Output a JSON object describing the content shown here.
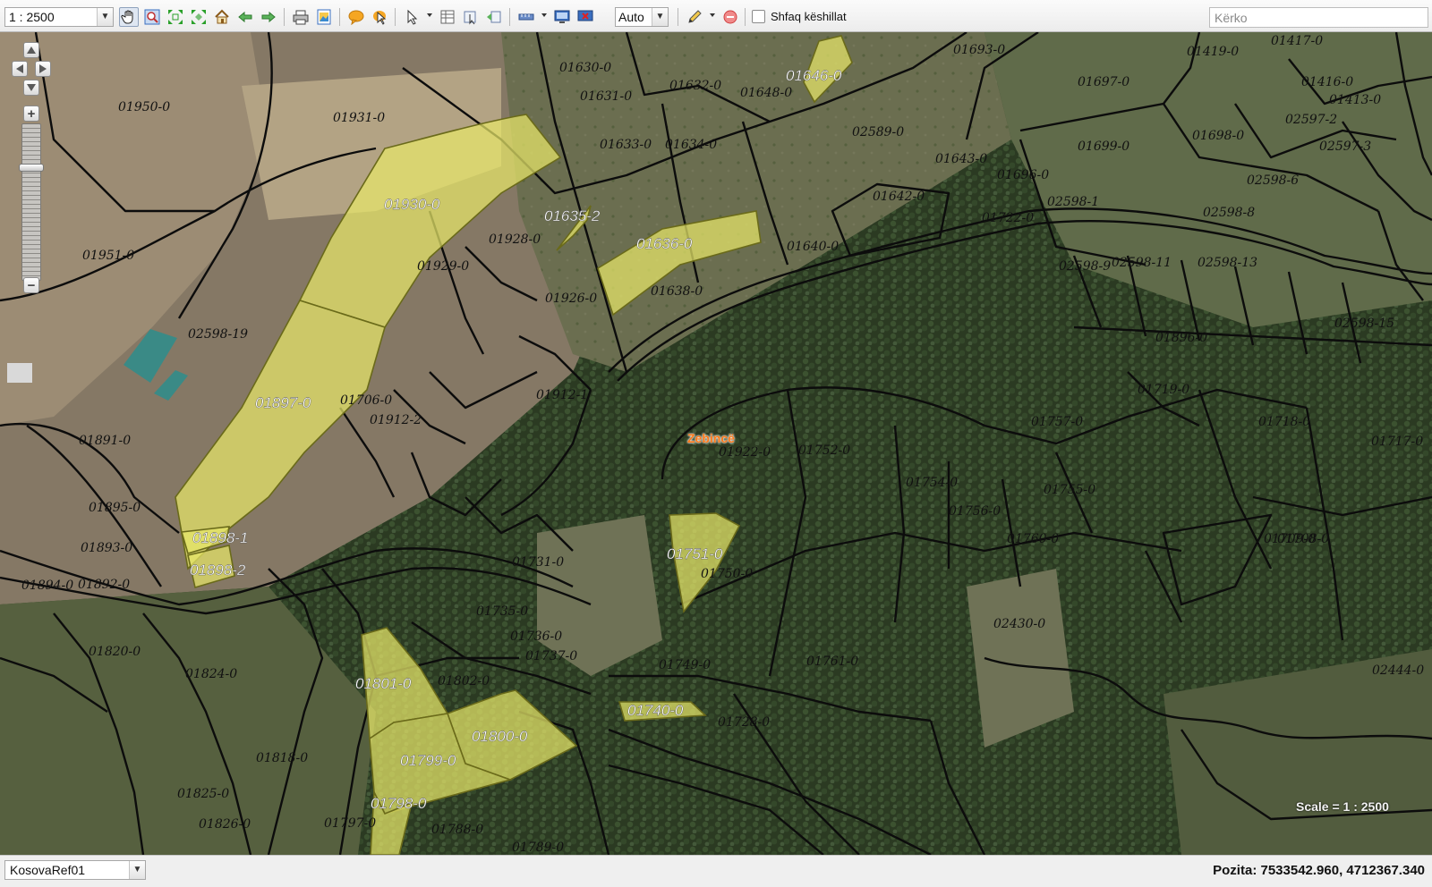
{
  "toolbar": {
    "scale_value": "1 : 2500",
    "zoom_mode_value": "Auto",
    "tips_label": "Shfaq këshillat",
    "tips_checked": false,
    "search_placeholder": "Kërko",
    "tools": [
      "hand-pan-icon",
      "zoom-box-icon",
      "zoom-extent-icon",
      "zoom-layer-icon",
      "home-icon",
      "back-arrow-icon",
      "forward-arrow-icon",
      "print-icon",
      "export-image-icon",
      "speech-bubble-icon",
      "identify-icon",
      "select-pointer-icon",
      "table-icon",
      "query-icon",
      "clear-selection-icon",
      "measure-ruler-icon",
      "coordinates-icon",
      "delete-map-icon",
      "pencil-icon",
      "remove-icon"
    ]
  },
  "map": {
    "place_name": "Zebincë",
    "scale_text": "Scale = 1 : 2500",
    "highlight_color": "#e8e86a",
    "selected_parcels": [
      "01646-0",
      "01930-0",
      "01635-2",
      "01636-0",
      "01897-0",
      "01898-1",
      "01898-2",
      "01751-0",
      "01801-0",
      "01800-0",
      "01799-0",
      "01798-0",
      "01740-0"
    ],
    "parcel_labels": [
      "01950-0",
      "01931-0",
      "01630-0",
      "01631-0",
      "01632-0",
      "01648-0",
      "01693-0",
      "01419-0",
      "01417-0",
      "01697-0",
      "01416-0",
      "01413-0",
      "01698-0",
      "01699-0",
      "02597-2",
      "02597-3",
      "02589-0",
      "01633-0",
      "01634-0",
      "01643-0",
      "01696-0",
      "01642-0",
      "02598-6",
      "02598-1",
      "02598-8",
      "01951-0",
      "01928-0",
      "01929-0",
      "01926-0",
      "01638-0",
      "01640-0",
      "01722-0",
      "02598-9",
      "02598-11",
      "02598-13",
      "02598-15",
      "02598-19",
      "01896-0",
      "01719-0",
      "01718-0",
      "01717-0",
      "01706-0",
      "01912-2",
      "01912-1",
      "01922-0",
      "01752-0",
      "01754-0",
      "01755-0",
      "01757-0",
      "01756-0",
      "01760-0",
      "01709-0",
      "01708-0",
      "01750-0",
      "01891-0",
      "01895-0",
      "01893-0",
      "01892-0",
      "01894-0",
      "01820-0",
      "01824-0",
      "01802-0",
      "01736-0",
      "01737-0",
      "01749-0",
      "01728-0",
      "01761-0",
      "02430-0",
      "02444-0",
      "01825-0",
      "01826-0",
      "01789-0",
      "01788-0",
      "01797-0",
      "01818-0",
      "01735-0",
      "01731-0"
    ]
  },
  "nav": {
    "pan_up": "pan-up-icon",
    "pan_down": "pan-down-icon",
    "pan_left": "pan-left-icon",
    "pan_right": "pan-right-icon",
    "zoom_in": "+",
    "zoom_out": "−",
    "zoom_level_fraction": 0.27
  },
  "status": {
    "layer_value": "KosovaRef01",
    "position_label": "Pozita:",
    "position_value": "7533542.960, 4712367.340"
  }
}
